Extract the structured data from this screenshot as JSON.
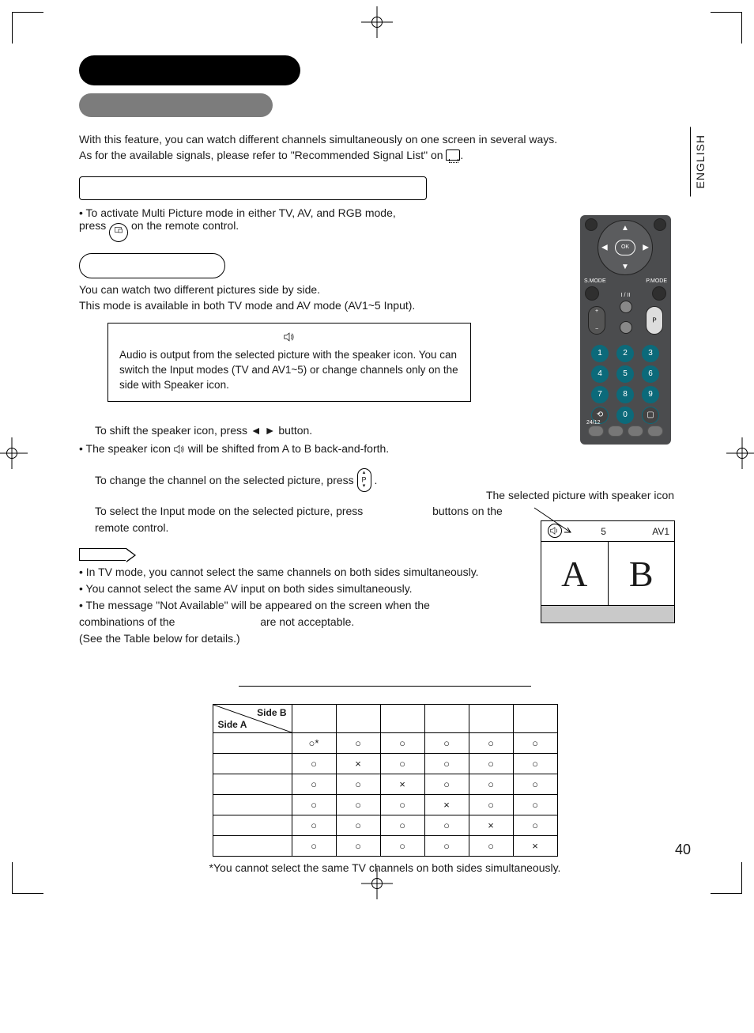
{
  "lang_tab": "ENGLISH",
  "page_number": "40",
  "intro_line1": "With this feature, you can watch different channels simultaneously on one screen in several ways.",
  "intro_line2a": "As for the available signals, please refer to \"Recommended Signal List\" on ",
  "intro_line2b": ".",
  "activate_line1": "• To activate Multi Picture mode in either TV, AV, and RGB mode,",
  "activate_line2a": "  press ",
  "activate_line2b": " on the remote control.",
  "twin_line1": "You can watch two different pictures side by side.",
  "twin_line2": "This mode is available in both TV mode and AV mode (AV1~5 Input).",
  "note_audio1": "Audio is output from the selected picture with the speaker icon.",
  "note_audio2": "You can switch the Input modes (TV and AV1~5) or change channels only on the side with Speaker icon.",
  "instr_shift": "To shift the speaker icon, press ◄ ► button.",
  "instr_speaker_a": "• The speaker icon ",
  "instr_speaker_b": " will be shifted from A to B back-and-forth.",
  "instr_change_a": "To change the channel on the selected picture, press ",
  "instr_change_b": ".",
  "instr_input_a": "To select the Input mode on the selected picture, press ",
  "instr_input_b": " buttons on the remote control.",
  "p_key_label": "P",
  "notes_bullet1": "• In TV mode, you cannot select the same channels on both sides simultaneously.",
  "notes_bullet2": "• You cannot select the same AV input on both sides simultaneously.",
  "notes_bullet3a": "• The message \"Not Available\" will be appeared on the screen when the",
  "notes_bullet3b": "  combinations of the ",
  "notes_bullet3c": " are not acceptable.",
  "notes_bullet4": "  (See the Table below for details.)",
  "selected_caption": "The selected picture with speaker icon",
  "ab_label_num": "5",
  "ab_label_av": "AV1",
  "ab_letter_a": "A",
  "ab_letter_b": "B",
  "diag_sb": "Side B",
  "diag_sa": "Side A",
  "table_foot": "*You cannot select the same TV channels on both sides simultaneously.",
  "t": {
    "r1": [
      "○*",
      "○",
      "○",
      "○",
      "○",
      "○"
    ],
    "r2": [
      "○",
      "×",
      "○",
      "○",
      "○",
      "○"
    ],
    "r3": [
      "○",
      "○",
      "×",
      "○",
      "○",
      "○"
    ],
    "r4": [
      "○",
      "○",
      "○",
      "×",
      "○",
      "○"
    ],
    "r5": [
      "○",
      "○",
      "○",
      "○",
      "×",
      "○"
    ],
    "r6": [
      "○",
      "○",
      "○",
      "○",
      "○",
      "×"
    ]
  },
  "remote_ok": "OK",
  "remote_smode": "S.MODE",
  "remote_pmode": "P.MODE",
  "remote_iii": "I / II",
  "remote_p": "P",
  "remote_2412": "24/12"
}
